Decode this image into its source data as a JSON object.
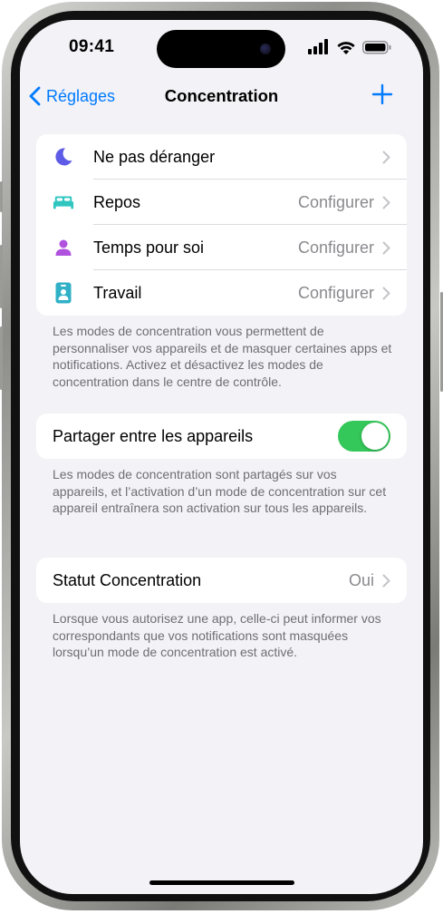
{
  "status_bar": {
    "time": "09:41"
  },
  "nav": {
    "back_label": "Réglages",
    "title": "Concentration"
  },
  "focus_modes": [
    {
      "label": "Ne pas déranger",
      "value": "",
      "icon": "moon-icon",
      "color": "#5e5ce6"
    },
    {
      "label": "Repos",
      "value": "Configurer",
      "icon": "bed-icon",
      "color": "#30c6c0"
    },
    {
      "label": "Temps pour soi",
      "value": "Configurer",
      "icon": "person-icon",
      "color": "#af52de"
    },
    {
      "label": "Travail",
      "value": "Configurer",
      "icon": "badge-icon",
      "color": "#30b0c7"
    }
  ],
  "focus_footnote": "Les modes de concentration vous permettent de personnaliser vos appareils et de masquer certaines apps et notifications. Activez et désactivez les modes de concentration dans le centre de contrôle.",
  "share": {
    "label": "Partager entre les appareils",
    "enabled": true
  },
  "share_footnote": "Les modes de concentration sont partagés sur vos appareils, et l’activation d’un mode de concentration sur cet appareil entraînera son activation sur tous les appareils.",
  "status": {
    "label": "Statut Concentration",
    "value": "Oui"
  },
  "status_footnote": "Lorsque vous autorisez une app, celle-ci peut informer vos correspondants que vos notifications sont masquées lorsqu’un mode de concentration est activé.",
  "colors": {
    "accent": "#007aff",
    "toggle_on": "#34c759",
    "background": "#f2f2f7"
  }
}
